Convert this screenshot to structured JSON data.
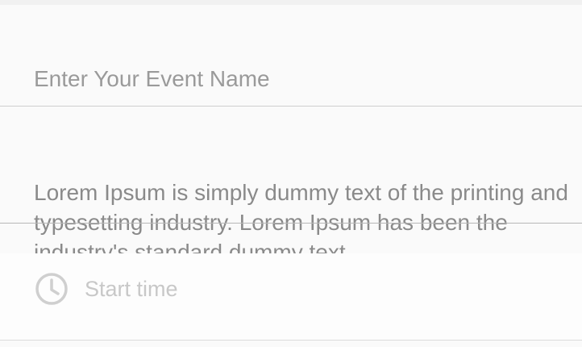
{
  "event_form": {
    "event_name": {
      "placeholder": "Enter Your Event Name",
      "value": ""
    },
    "description": {
      "text": "Lorem Ipsum is simply dummy text of the printing and typesetting industry. Lorem Ipsum has been the industry's standard dummy text"
    },
    "start_time": {
      "label": "Start time",
      "icon": "clock-icon"
    }
  },
  "colors": {
    "background": "#fafafa",
    "placeholder_text": "#9a9a9a",
    "body_text": "#8a8a8a",
    "muted_text": "#c8c8c8",
    "divider": "#cfcfcf"
  }
}
